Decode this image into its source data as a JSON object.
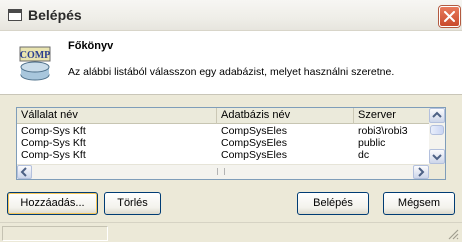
{
  "window": {
    "title": "Belépés",
    "close_icon": "close-icon"
  },
  "header": {
    "logo_text": "COMP",
    "title": "Főkönyv",
    "subtitle": "Az alábbi listából válasszon egy adabázist, melyet használni szeretne."
  },
  "list": {
    "columns": [
      "Vállalat név",
      "Adatbázis név",
      "Szerver"
    ],
    "rows": [
      {
        "company": "Comp-Sys Kft",
        "database": "CompSysEles",
        "server": "robi3\\robi3"
      },
      {
        "company": "Comp-Sys Kft",
        "database": "CompSysEles",
        "server": "public"
      },
      {
        "company": "Comp-Sys Kft",
        "database": "CompSysEles",
        "server": "dc"
      }
    ]
  },
  "buttons": {
    "add": "Hozzáadás...",
    "delete": "Törlés",
    "login": "Belépés",
    "cancel": "Mégsem"
  },
  "colors": {
    "dialog_bg": "#ece9d8",
    "close_button": "#d55a3a",
    "list_border": "#7f9db9",
    "button_border": "#003c74"
  }
}
